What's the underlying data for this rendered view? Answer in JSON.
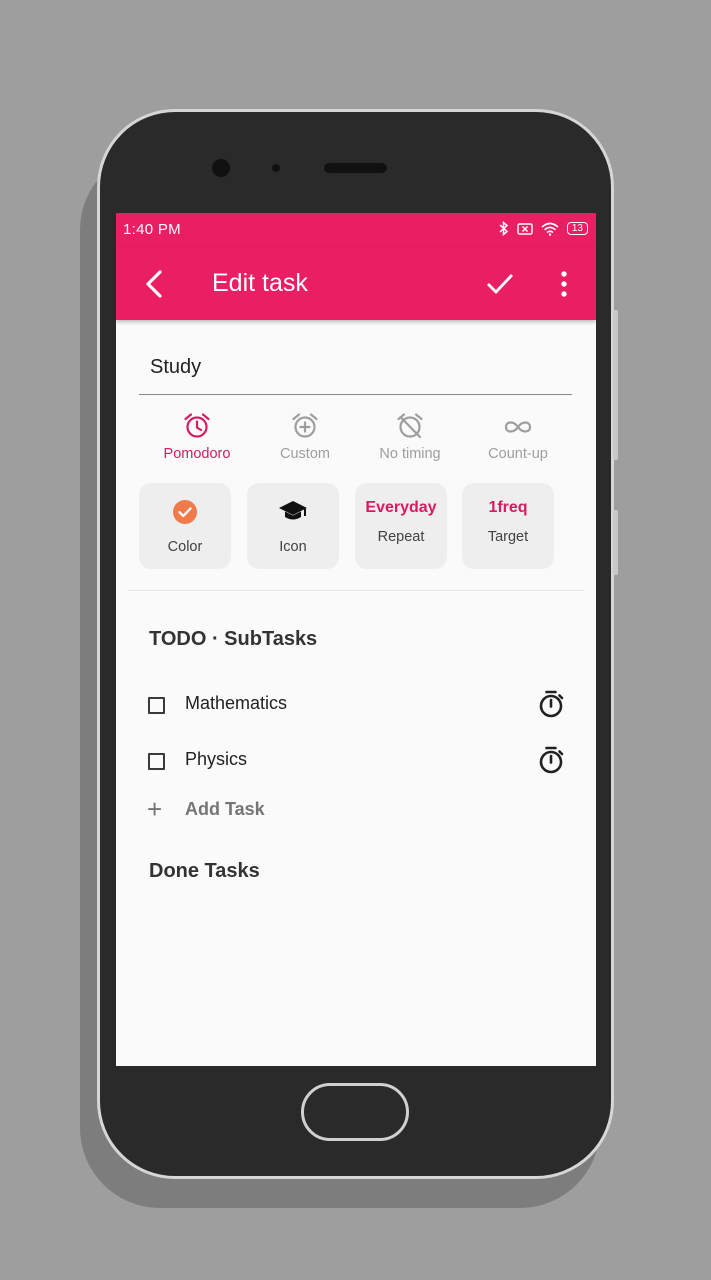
{
  "status_bar": {
    "time": "1:40 PM",
    "battery": "13",
    "icons": [
      "bluetooth-icon",
      "sim-icon",
      "wifi-icon",
      "battery-icon"
    ]
  },
  "app_bar": {
    "title": "Edit task"
  },
  "task": {
    "name": "Study"
  },
  "timing_modes": [
    {
      "label": "Pomodoro",
      "icon": "alarm-clock-icon",
      "selected": true
    },
    {
      "label": "Custom",
      "icon": "alarm-plus-icon",
      "selected": false
    },
    {
      "label": "No timing",
      "icon": "alarm-off-icon",
      "selected": false
    },
    {
      "label": "Count-up",
      "icon": "infinity-icon",
      "selected": false
    }
  ],
  "option_cards": [
    {
      "label": "Color",
      "icon": "check-circle-icon"
    },
    {
      "label": "Icon",
      "icon": "graduation-cap-icon"
    },
    {
      "value": "Everyday",
      "label": "Repeat"
    },
    {
      "value": "1freq",
      "label": "Target"
    }
  ],
  "todo_section": {
    "title": "TODO · SubTasks",
    "tasks": [
      {
        "name": "Mathematics",
        "checked": false
      },
      {
        "name": "Physics",
        "checked": false
      }
    ],
    "add_label": "Add Task"
  },
  "done_section": {
    "title": "Done Tasks"
  },
  "colors": {
    "accent": "#e91e63",
    "selected_mode": "#d81b60",
    "color_swatch": "#f07a4a"
  }
}
